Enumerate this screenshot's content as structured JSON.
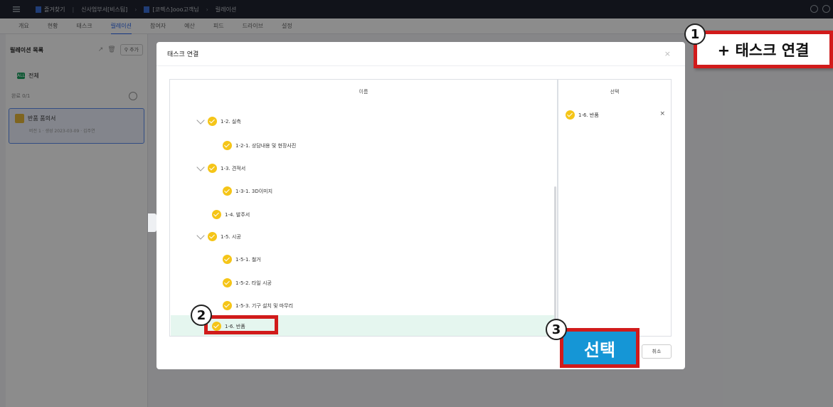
{
  "topbar": {
    "favorites": "즐겨찾기",
    "crumbs": [
      "신사업부서[비스팀]",
      "[코렉스]ooo고객님",
      "릴레이션"
    ]
  },
  "tabs": [
    "개요",
    "현황",
    "태스크",
    "릴레이션",
    "참여자",
    "예산",
    "피드",
    "드라이브",
    "설정"
  ],
  "active_tab": "릴레이션",
  "sidebar": {
    "title": "릴레이션 목록",
    "add_label": "추가",
    "all_label": "전체",
    "all_badge": "ALL",
    "count_label": "완료 0/1",
    "card_title": "반품 품의서",
    "card_meta": "버전 1 · 생성 2023-03-09 · 김주연"
  },
  "modal": {
    "title": "태스크 연결",
    "tree_header": "이름",
    "select_header": "선택",
    "nodes": [
      {
        "label": "1-2. 실측",
        "expand": true
      },
      {
        "label": "1-2-1. 상담내용 및 현장사진",
        "expand": false
      },
      {
        "label": "1-3. 견적서",
        "expand": true
      },
      {
        "label": "1-3-1. 3D이미지",
        "expand": false
      },
      {
        "label": "1-4. 발주서",
        "expand": false
      },
      {
        "label": "1-5. 시공",
        "expand": true
      },
      {
        "label": "1-5-1. 철거",
        "expand": false
      },
      {
        "label": "1-5-2. 타일 시공",
        "expand": false
      },
      {
        "label": "1-5-3. 기구 설치 및 마무리",
        "expand": false
      },
      {
        "label": "1-6. 반품",
        "expand": false
      }
    ],
    "selected_item": "1-6. 반품",
    "remove_symbol": "×",
    "close_symbol": "×",
    "confirm_label": "선택",
    "cancel_label": "취소"
  },
  "callouts": {
    "step1": "1",
    "step1_text": "+ 태스크 연결",
    "step2": "2",
    "step3": "3"
  },
  "colors": {
    "accent": "#2563eb",
    "check": "#f5c518",
    "highlight_row": "#e5f6ef",
    "callout_red": "#d11b1b",
    "select_button": "#1596d6"
  }
}
